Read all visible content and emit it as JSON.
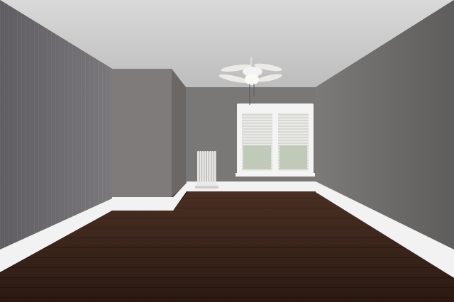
{
  "scene": {
    "colors": {
      "ceiling": "#d9d9d9",
      "ceiling_shadow": "#bdbdbd",
      "wall_left": "#6e6c70",
      "wall_back": "#7a7877",
      "wall_alcove": "#7f7b7a",
      "wall_alcove_side": "#6a6765",
      "wall_right": "#6f6d6c",
      "baseboard": "#f2f2f2",
      "baseboard_shadow": "#c9c9c9",
      "floor_dark": "#2b1a12",
      "floor_mid": "#4a2f22",
      "window_frame": "#f4f4f4",
      "window_blind": "#e9e9e6",
      "window_glass": "#9bb08c",
      "radiator": "#e8e8e8",
      "fan_body": "#f3f3f3",
      "fan_blade": "#ecebe8"
    },
    "icons": {
      "ceiling_fan": "ceiling-fan-icon",
      "radiator": "radiator-icon",
      "window": "window-icon"
    }
  }
}
